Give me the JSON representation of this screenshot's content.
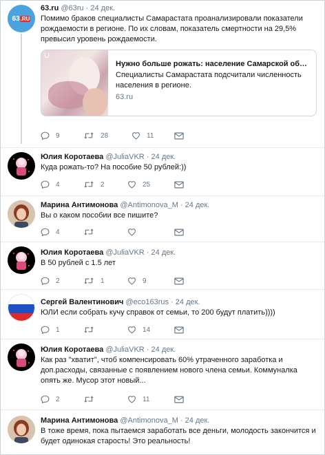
{
  "icons": {
    "reply": "reply-icon",
    "retweet": "retweet-icon",
    "like": "heart-icon",
    "dm": "envelope-icon"
  },
  "tweets": [
    {
      "name": "63.ru",
      "handle": "@63ru",
      "dot": "·",
      "date": "24 дек.",
      "text": "Помимо браков специалисты Самарастата проанализировали показатели рождаемости в регионе. По их словам, показатель смертности на 29,5% превысил уровень рождаемости.",
      "card": {
        "image_label": "U",
        "title": "Нужно больше рожать: население Самарской об…",
        "description": "Специалисты Самарастата подсчитали численность населения в регионе.",
        "domain": "63.ru"
      },
      "replies": "9",
      "retweets": "28",
      "likes": "11"
    },
    {
      "name": "Юлия Коротаева",
      "handle": "@JuliaVKR",
      "dot": "·",
      "date": "24 дек.",
      "text": "Куда рожать-то? На пособие 50 рублей:))",
      "replies": "4",
      "retweets": "2",
      "likes": "25"
    },
    {
      "name": "Марина Антимонова",
      "handle": "@Antimonova_M",
      "dot": "·",
      "date": "24 дек.",
      "text": "Вы о каком пособии все пишите?",
      "replies": "4",
      "retweets": "",
      "likes": ""
    },
    {
      "name": "Юлия Коротаева",
      "handle": "@JuliaVKR",
      "dot": "·",
      "date": "24 дек.",
      "text": "В 50 рублей с 1.5 лет",
      "replies": "2",
      "retweets": "1",
      "likes": "9"
    },
    {
      "name": "Сергей Валентинович",
      "handle": "@eco163rus",
      "dot": "·",
      "date": "24 дек.",
      "text": "ЮЛИ если собрать кучу справок от семьи, то 200 будут платить))))",
      "replies": "1",
      "retweets": "",
      "likes": "14"
    },
    {
      "name": "Юлия Коротаева",
      "handle": "@JuliaVKR",
      "dot": "·",
      "date": "24 дек.",
      "text": "Как раз \"хватит\", чтоб компенсировать 60% утраченного заработка и доп.расходы, связанные с появлением нового члена семьи. Коммуналка опять же. Мусор этот новый...",
      "replies": "2",
      "retweets": "",
      "likes": "11"
    },
    {
      "name": "Марина Антимонова",
      "handle": "@Antimonova_M",
      "dot": "·",
      "date": "24 дек.",
      "text": "В тоже время, пока пытаемся заработать все деньги, молодость закончится и будет одинокая старость! Это реальность!"
    }
  ]
}
